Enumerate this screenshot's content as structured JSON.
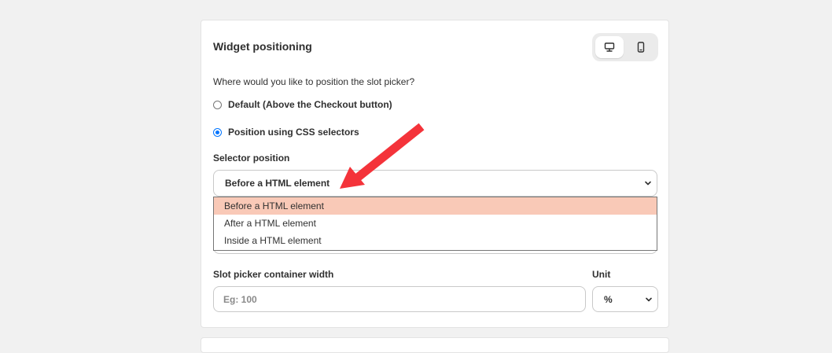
{
  "card": {
    "title": "Widget positioning",
    "device_toggle": {
      "desktop_icon": "desktop-icon",
      "mobile_icon": "mobile-icon",
      "selected": "desktop"
    },
    "question": "Where would you like to position the slot picker?",
    "options": [
      {
        "label": "Default (Above the Checkout button)",
        "checked": false
      },
      {
        "label": "Position using CSS selectors",
        "checked": true
      }
    ],
    "selector_position": {
      "label": "Selector position",
      "value": "Before a HTML element",
      "dropdown_options": [
        "Before a HTML element",
        "After a HTML element",
        "Inside a HTML element"
      ],
      "highlighted_index": 0
    },
    "width": {
      "label": "Slot picker container width",
      "placeholder": "Eg: 100"
    },
    "unit": {
      "label": "Unit",
      "value": "%"
    }
  },
  "colors": {
    "accent": "#0075ff",
    "highlight": "#f9c9b7",
    "arrow": "#f4333a"
  }
}
